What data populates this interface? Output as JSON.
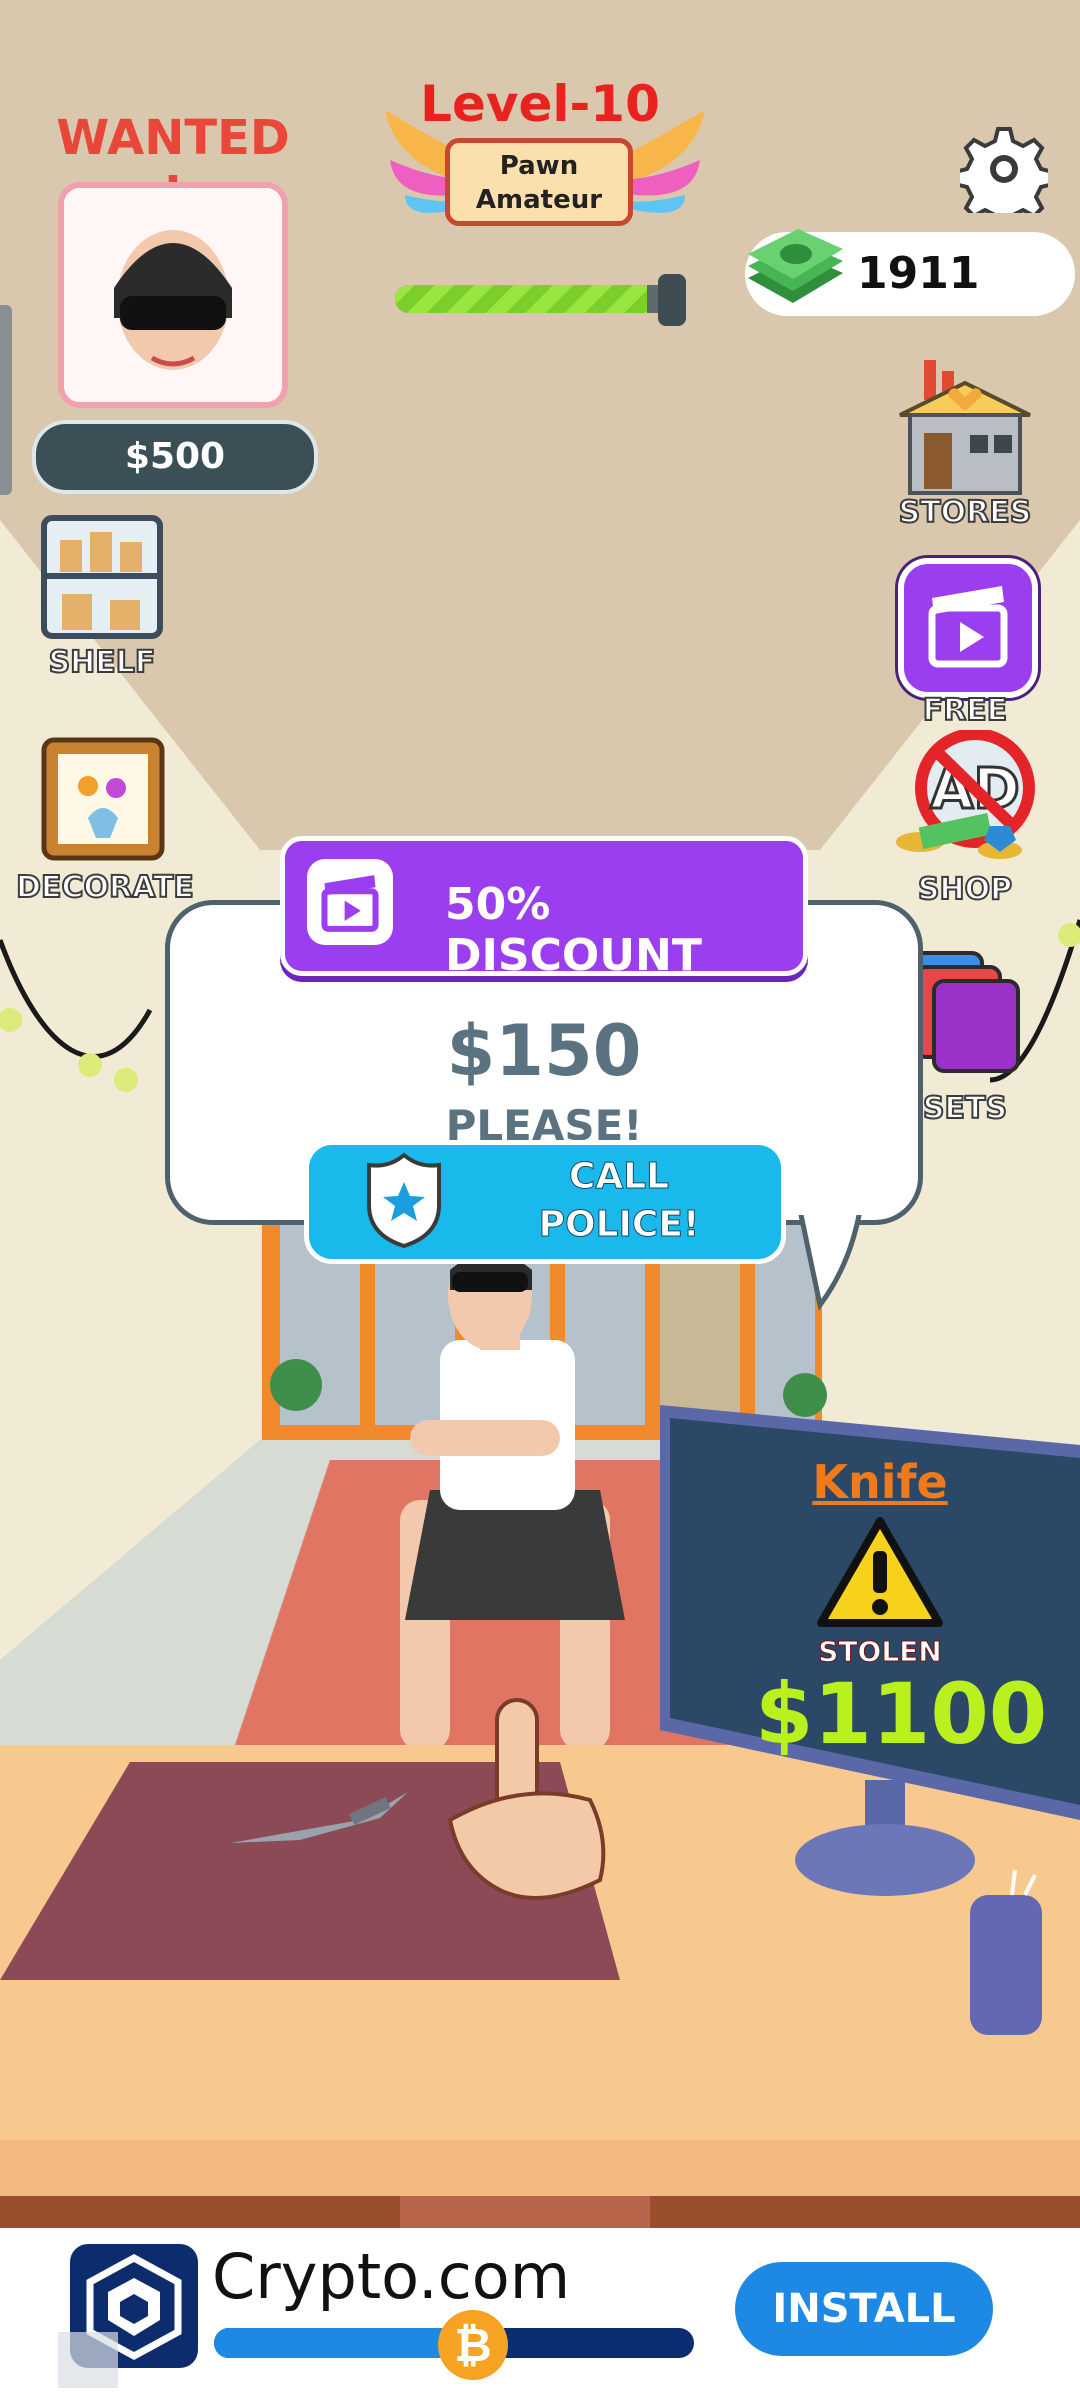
{
  "hud": {
    "wanted_label": "WANTED !",
    "bounty": "$500",
    "level_title": "Level-10",
    "rank_line1": "Pawn",
    "rank_line2": "Amateur",
    "level_progress": 0.9,
    "cash": "1911"
  },
  "left_menu": [
    {
      "label": "SHELF",
      "icon": "shelf-icon"
    },
    {
      "label": "DECORATE",
      "icon": "picture-frame-icon"
    }
  ],
  "right_menu": [
    {
      "label": "STORES",
      "icon": "store-icon"
    },
    {
      "label": "FREE",
      "icon": "video-clapper-icon"
    },
    {
      "label": "SHOP",
      "icon": "no-ads-icon"
    },
    {
      "label": "SETS",
      "icon": "stacked-cards-icon"
    }
  ],
  "dialog": {
    "discount_label": "50% DISCOUNT",
    "price": "$150",
    "please": "PLEASE!",
    "police_line1": "CALL",
    "police_line2": "POLICE!"
  },
  "monitor": {
    "item_name": "Knife",
    "status": "STOLEN",
    "value": "$1100"
  },
  "ad": {
    "brand": "Crypto.com",
    "install_label": "INSTALL",
    "accent": "#1e88e5"
  }
}
